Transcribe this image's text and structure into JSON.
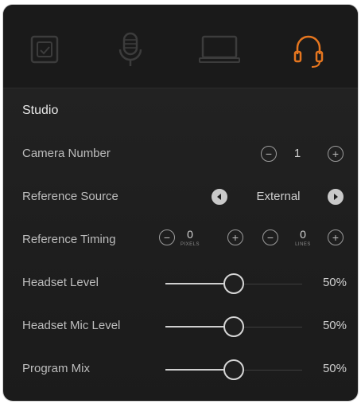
{
  "tabs": [
    {
      "icon": "camera-settings-icon",
      "active": false
    },
    {
      "icon": "microphone-icon",
      "active": false
    },
    {
      "icon": "monitor-icon",
      "active": false
    },
    {
      "icon": "headset-icon",
      "active": true
    }
  ],
  "colors": {
    "accent": "#e6761f",
    "inactive_icon": "#3c3c3c"
  },
  "section": {
    "title": "Studio"
  },
  "camera_number": {
    "label": "Camera Number",
    "value": "1"
  },
  "reference_source": {
    "label": "Reference Source",
    "value": "External"
  },
  "reference_timing": {
    "label": "Reference Timing",
    "pixels_value": "0",
    "pixels_unit": "PIXELS",
    "lines_value": "0",
    "lines_unit": "LINES"
  },
  "headset_level": {
    "label": "Headset Level",
    "value": "50%",
    "level": 0.5
  },
  "headset_mic_level": {
    "label": "Headset Mic Level",
    "value": "50%",
    "level": 0.5
  },
  "program_mix": {
    "label": "Program Mix",
    "value": "50%",
    "level": 0.5
  }
}
